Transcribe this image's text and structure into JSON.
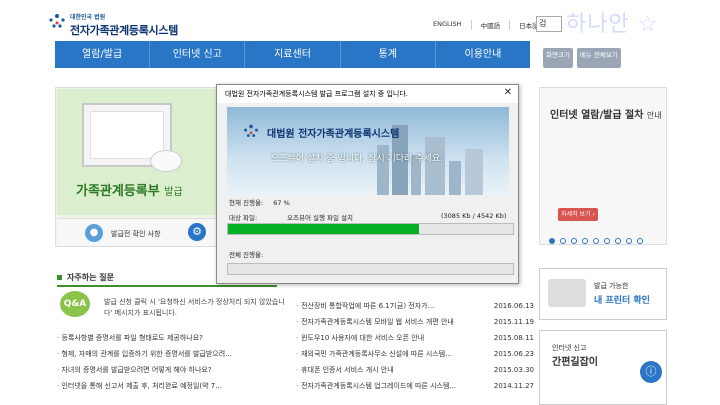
{
  "header": {
    "org_small": "대한민국 법원",
    "org_title": "전자가족관계등록시스템",
    "languages": [
      "ENGLISH",
      "中國語",
      "日本語"
    ],
    "search_text": "검",
    "watermark": "하나안 ☆"
  },
  "nav": {
    "items": [
      "열람/발급",
      "인터넷 신고",
      "지료센터",
      "통계",
      "이용안내"
    ],
    "tools": [
      "화면크기",
      "메뉴 전체보기"
    ]
  },
  "banner": {
    "title": "가족관계등록부",
    "title_suffix": "발급",
    "strip_label": "발급전 확인 사항",
    "gear": "⚙"
  },
  "faq": {
    "heading": "자주하는 질문",
    "qa_badge": "Q&A",
    "qa_text": "발급 신청 클릭 시 '요청하신 서비스가 정상처리 되지 않았습니다' 메시지가 표시됩니다.",
    "items": [
      "등록사항별 증명서를 파일 형태로도 제공하나요?",
      "형제, 자매의 관계를 입증하기 위한 증명서를 발급받으려...",
      "자녀의 증명서를 발급받으려면 어떻게 해야 하나요?",
      "인터넷을 통해 신고서 제출 후, 처리완료 예정일(약 7..."
    ]
  },
  "notices": [
    {
      "title": "전산장비 통합작업에 따른 6.17(금) 전자가...",
      "date": "2016.06.13"
    },
    {
      "title": "전자가족관계등록시스템 모바일 웹 서비스 개편 안내",
      "date": "2015.11.19"
    },
    {
      "title": "윈도우10 사용자에 대한 서비스 오픈 안내",
      "date": "2015.08.11"
    },
    {
      "title": "재외국민 가족관계등록사무소 신설에 따른 시스템...",
      "date": "2015.06.23"
    },
    {
      "title": "휴대폰 인증서 서비스 개시 안내",
      "date": "2015.03.30"
    },
    {
      "title": "전자가족관계등록시스템 업그레이드에 따른 시스템...",
      "date": "2014.11.27"
    }
  ],
  "right": {
    "proc_title": "인터넷 열람/발급 절차",
    "proc_suffix": "안내",
    "proc_button": "자세히 보기 ›",
    "pager_count": 9,
    "pager_active": 0,
    "printer_l1": "발급 가능한",
    "printer_l2": "내 프린터 확인",
    "guide_l1": "인터넷 신고",
    "guide_l2": "간편길잡이",
    "guide_icon": "ⓘ"
  },
  "dialog": {
    "title": "대법원 전자가족관계등록시스템 발급 프로그램 설치 중 입니다.",
    "close": "✕",
    "art_name": "대법원 전자가족관계등록시스템",
    "art_msg": "오즈뷰어 설치 중 입니다. 잠시 기다려 주세요.",
    "current_label": "현재 진행율:",
    "current_percent": "67 %",
    "current_fraction": 0.67,
    "target_label": "대상 파일:",
    "target_file": "오즈뷰어 실행 파일 설치",
    "target_size": "(3085 Kb / 4542 Kb)",
    "total_label": "전체 진행율:",
    "total_fraction": 0.0
  },
  "colors": {
    "nav": "#2a76c6",
    "progress": "#06b025",
    "accent_green": "#3d8f2c"
  }
}
